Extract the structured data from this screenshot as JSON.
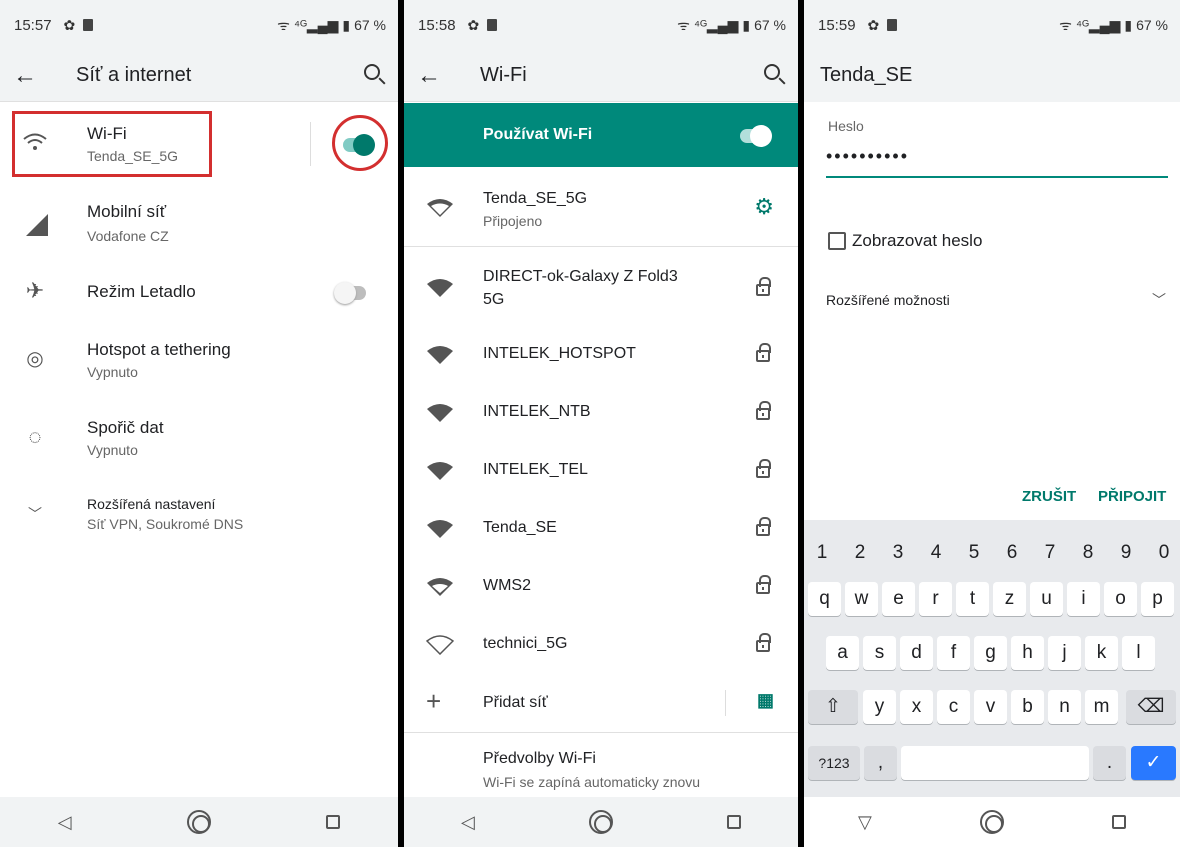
{
  "s1": {
    "time": "15:57",
    "battery": "67 %",
    "title": "Síť a internet",
    "items": [
      {
        "title": "Wi-Fi",
        "sub": "Tenda_SE_5G"
      },
      {
        "title": "Mobilní síť",
        "sub": "Vodafone CZ"
      },
      {
        "title": "Režim Letadlo",
        "sub": ""
      },
      {
        "title": "Hotspot a tethering",
        "sub": "Vypnuto"
      },
      {
        "title": "Spořič dat",
        "sub": "Vypnuto"
      },
      {
        "title": "Rozšířená nastavení",
        "sub": "Síť VPN, Soukromé DNS"
      }
    ]
  },
  "s2": {
    "time": "15:58",
    "battery": "67 %",
    "title": "Wi-Fi",
    "use_wifi": "Používat Wi-Fi",
    "networks": [
      {
        "name": "Tenda_SE_5G",
        "sub": "Připojeno"
      },
      {
        "name": "DIRECT-ok-Galaxy Z Fold3",
        "sub": "5G"
      },
      {
        "name": "INTELEK_HOTSPOT",
        "sub": ""
      },
      {
        "name": "INTELEK_NTB",
        "sub": ""
      },
      {
        "name": "INTELEK_TEL",
        "sub": ""
      },
      {
        "name": "Tenda_SE",
        "sub": ""
      },
      {
        "name": "WMS2",
        "sub": ""
      },
      {
        "name": "technici_5G",
        "sub": ""
      }
    ],
    "add": "Přidat síť",
    "prefs": "Předvolby Wi-Fi",
    "prefs_sub": "Wi-Fi se zapíná automaticky znovu"
  },
  "s3": {
    "time": "15:59",
    "battery": "67 %",
    "title": "Tenda_SE",
    "pw_label": "Heslo",
    "pw_value": "••••••••••",
    "show_pw": "Zobrazovat heslo",
    "advanced": "Rozšířené možnosti",
    "cancel": "ZRUŠIT",
    "connect": "PŘIPOJIT",
    "keys": {
      "nums": [
        "1",
        "2",
        "3",
        "4",
        "5",
        "6",
        "7",
        "8",
        "9",
        "0"
      ],
      "row1": [
        "q",
        "w",
        "e",
        "r",
        "t",
        "z",
        "u",
        "i",
        "o",
        "p"
      ],
      "row2": [
        "a",
        "s",
        "d",
        "f",
        "g",
        "h",
        "j",
        "k",
        "l"
      ],
      "row3": [
        "y",
        "x",
        "c",
        "v",
        "b",
        "n",
        "m"
      ],
      "sym": "?123",
      "comma": ",",
      "dot": "."
    }
  },
  "colors": {
    "accent": "#00796b",
    "teal_bar": "#00897b",
    "highlight": "#d32f2f",
    "enter": "#2979ff"
  }
}
